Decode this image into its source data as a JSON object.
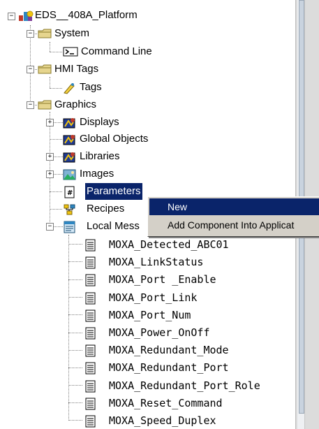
{
  "tree": {
    "root": {
      "label": "EDS__408A_Platform",
      "icon": "project-icon"
    },
    "system": {
      "label": "System",
      "icon": "folder-icon"
    },
    "command_line": {
      "label": "Command Line",
      "icon": "console-icon"
    },
    "hmi_tags": {
      "label": "HMI Tags",
      "icon": "folder-icon"
    },
    "tags": {
      "label": "Tags",
      "icon": "tags-icon"
    },
    "graphics": {
      "label": "Graphics",
      "icon": "folder-icon"
    },
    "displays": {
      "label": "Displays",
      "icon": "displays-icon"
    },
    "global_objects": {
      "label": "Global Objects",
      "icon": "global-objects-icon"
    },
    "libraries": {
      "label": "Libraries",
      "icon": "libraries-icon"
    },
    "images": {
      "label": "Images",
      "icon": "images-icon"
    },
    "parameters": {
      "label": "Parameters",
      "icon": "parameters-icon"
    },
    "recipes": {
      "label": "Recipes",
      "icon": "recipes-icon"
    },
    "local_messages": {
      "label": "Local Mess",
      "icon": "local-messages-icon"
    },
    "messages": [
      "MOXA_Detected_ABC01",
      "MOXA_LinkStatus",
      "MOXA_Port _Enable",
      "MOXA_Port_Link",
      "MOXA_Port_Num",
      "MOXA_Power_OnOff",
      "MOXA_Redundant_Mode",
      "MOXA_Redundant_Port",
      "MOXA_Redundant_Port_Role",
      "MOXA_Reset_Command",
      "MOXA_Speed_Duplex"
    ]
  },
  "context_menu": {
    "items": [
      "New",
      "Add Component Into Applicat"
    ]
  },
  "colors": {
    "selection": "#0a246a",
    "menu_bg": "#d4d0c8"
  }
}
